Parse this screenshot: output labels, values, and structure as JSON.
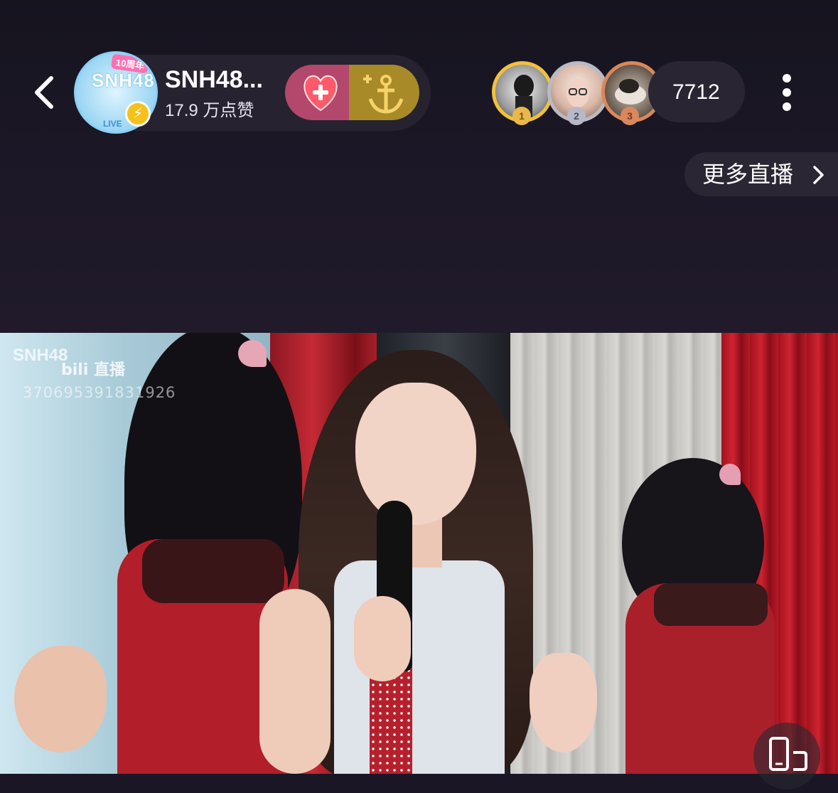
{
  "header": {
    "back_icon": "chevron-left-icon",
    "channel": {
      "name": "SNH48...",
      "likes": "17.9 万点赞",
      "avatar_text": "SNH48",
      "avatar_badge": "10周年",
      "avatar_sub": "LIVE",
      "verified_icon": "lightning-icon"
    },
    "follow_icon": "heart-plus-icon",
    "fan_icon": "anchor-plus-icon",
    "top_viewers": [
      {
        "rank": "1",
        "medal_color": "#f2c13b"
      },
      {
        "rank": "2",
        "medal_color": "#b9bac6"
      },
      {
        "rank": "3",
        "medal_color": "#d9885a"
      }
    ],
    "viewer_count": "7712",
    "more_icon": "more-vertical-icon"
  },
  "more_live": {
    "label": "更多直播",
    "icon": "chevron-right-icon"
  },
  "video": {
    "watermark": {
      "logo": "SNH48",
      "brand": "bili 直播",
      "id": "370695391831926"
    },
    "rotate_icon": "screen-rotate-icon"
  },
  "colors": {
    "follow": "#b3486c",
    "fan": "#a88a28",
    "background": "#1a1625"
  }
}
